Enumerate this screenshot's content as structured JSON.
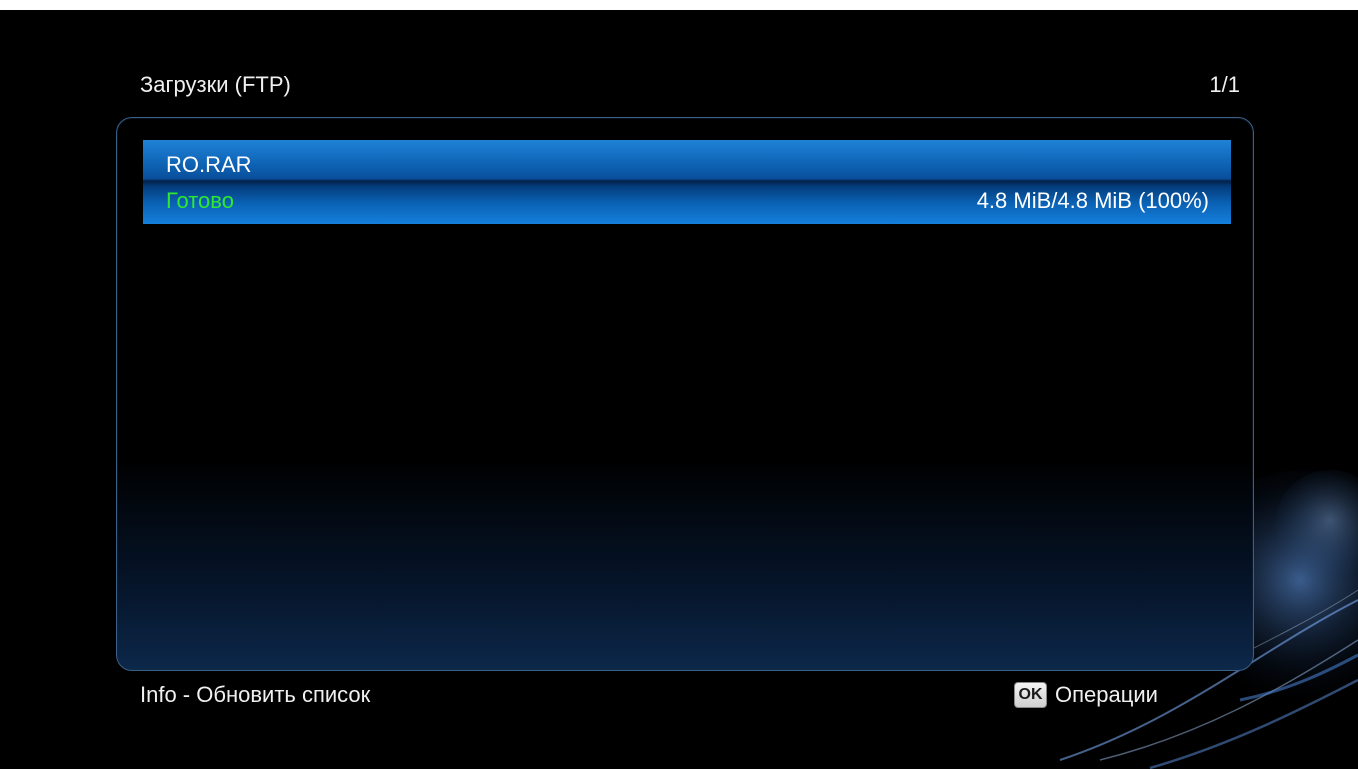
{
  "header": {
    "title": "Загрузки (FTP)",
    "pager": "1/1"
  },
  "downloads": {
    "items": [
      {
        "name": "RO.RAR",
        "status": "Готово",
        "size": "4.8 MiB/4.8 MiB (100%)",
        "progress_percent": 100
      }
    ]
  },
  "footer": {
    "info_hint": "Info - Обновить список",
    "ok_icon_label": "OK",
    "ok_hint": "Операции"
  },
  "colors": {
    "background": "#000000",
    "selection": "#0f64b6",
    "status_done": "#2ee831",
    "text": "#f0f0f0"
  },
  "icons": {
    "ok_button": "ok-remote-key-icon"
  }
}
